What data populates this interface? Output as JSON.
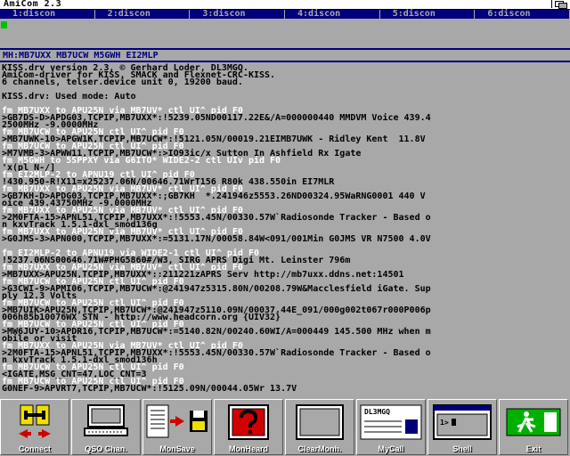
{
  "window": {
    "title": "AmiCom 2.3"
  },
  "channels": [
    {
      "label": "1:discon"
    },
    {
      "label": "2:discon"
    },
    {
      "label": "3:discon"
    },
    {
      "label": "4:discon"
    },
    {
      "label": "5:discon"
    },
    {
      "label": "6:discon"
    }
  ],
  "callsign_bar": "MH:MB7UXX MB7UCW M5GWH   EI2MLP",
  "monitor": {
    "lines": [
      {
        "t": "KISS.drv version 2.3, © Gerhard Loder, DL3MGQ.",
        "c": "b"
      },
      {
        "t": "AmiCom-driver for KISS, SMACK and Flexnet-CRC-KISS.",
        "c": "b"
      },
      {
        "t": "6 channels, telser.device unit 0, 19200 baud.",
        "c": "b"
      },
      {
        "t": "",
        "c": "b"
      },
      {
        "t": "KISS.drv: Used mode: Auto",
        "c": "b"
      },
      {
        "t": "",
        "c": "b"
      },
      {
        "t": "fm MB7UXX to APU25N via MB7UV* ctl UI^ pid F0",
        "c": "w"
      },
      {
        "t": ">GB7DS-D>APDG03,TCPIP,MB7UXX*:!5239.05ND00117.22E&/A=000000440 MMDVM Voice 439.4",
        "c": "b"
      },
      {
        "t": "2500MHz -9.0000MHz",
        "c": "b"
      },
      {
        "t": "fm MB7UCW to APU25N ctl UI^ pid F0",
        "c": "w"
      },
      {
        "t": ">MB7UWK-10>APGW1K,TCPIP,MB7UCW*:!5121.05N/00019.21EIMB7UWK - Ridley Kent  11.8V",
        "c": "b"
      },
      {
        "t": "fm MB7UCW to APU25N ctl UI^ pid F0",
        "c": "w"
      },
      {
        "t": ">M7VMB-3>APWW11,TCPIP,MB7UCW*:>IO93ic/x Sutton In Ashfield Rx Igate",
        "c": "b"
      },
      {
        "t": "fm M5GWH to 5SPPXY via G6ITO* WIDE2-2 ctl UIv pid F0",
        "c": "w"
      },
      {
        "t": "'x(pl N-/]",
        "c": "b"
      },
      {
        "t": "fm EI2MLP-2 to APNU19 ctl UI^ pid F0",
        "c": "w"
      },
      {
        "t": "!430.950-R!X11=x25237.06N/00646.71WrT156 R80k 438.550in EI7MLR",
        "c": "b"
      },
      {
        "t": "fm MB7UXX to APU25N via MB7UV* ctl UI^ pid F0",
        "c": "w"
      },
      {
        "t": ">GB7KH-D>APDG03,TCPIP,MB7UXX*:;GB7KH  *.241946z5553.26ND00324.95WaRNG0001 440 V",
        "c": "b"
      },
      {
        "t": "oice 439.43750MHz -9.0000MHz",
        "c": "b"
      },
      {
        "t": "fm MB7UXX to APU25N via MB7UV* ctl UI^ pid F0",
        "c": "w"
      },
      {
        "t": ">2M0FTA-15>APNL51,TCPIP,MB7UXX*:!5553.45N/00330.57W`Radiosonde Tracker - Based o",
        "c": "b"
      },
      {
        "t": "n kxvTrack 1.5.1-dxl_smod136g",
        "c": "b"
      },
      {
        "t": "fm MB7UXX to APU25N via MB7UV* ctl UI^ pid F0",
        "c": "w"
      },
      {
        "t": ">G0JMS-3>APN000,TCPIP,MB7UXX*:=5131.17N/00058.84W<091/001Min G0JMS VR N7500 4.0V",
        "c": "b"
      },
      {
        "t": "",
        "c": "b"
      },
      {
        "t": "fm EI2MLP-2 to APNU19 via WIDE2-1 ctl UI^ pid F0",
        "c": "w"
      },
      {
        "t": "!5237.06NS00646.71W#PHG5860#/W3, SIRG APRS Digi Mt. Leinster 796m",
        "c": "b"
      },
      {
        "t": "fm MB7UXX to APU25N via MB7UV* ctl UI^ pid F0",
        "c": "w"
      },
      {
        "t": ">MB7UXX>APU25N,TCPIP,MB7UXX*:;211221zAPRS Serv http://mb7uxx.ddns.net:14501",
        "c": "b"
      },
      {
        "t": "fm MB7UCW to APU25N ctl UI^ pid F0",
        "c": "w"
      },
      {
        "t": ">G3CWI-9>APMI06,TCPIP,MB7UCW*:@241947z5315.80N/00208.79W&Macclesfield iGate. Sup",
        "c": "b"
      },
      {
        "t": "ply 12.3 Volts",
        "c": "b"
      },
      {
        "t": "fm MB7UCW to APU25N ctl UI^ pid F0",
        "c": "w"
      },
      {
        "t": ">MB7UIK>APU25N,TCPIP,MB7UCW*:@241947z5110.09N/00037.44E_091/000g002t067r000P006p",
        "c": "b"
      },
      {
        "t": "006h85b10076WX STN - http://www.headcorn.org {UIV32}",
        "c": "b"
      },
      {
        "t": "fm MB7UCW to APU25N ctl UI^ pid F0",
        "c": "w"
      },
      {
        "t": ">MW6JUY-10>APDR16,TCPIP,MB7UCW*:=5140.82N/00240.60WI/A=000449 145.500 MHz when m",
        "c": "b"
      },
      {
        "t": "obile or visit",
        "c": "b"
      },
      {
        "t": "fm MB7UXX to APU25N via MB7UV* ctl UI^ pid F0",
        "c": "w"
      },
      {
        "t": ">2M0FTA-15>APNL51,TCPIP,MB7UXX*:!5553.45N/00330.57W`Radiosonde Tracker - Based o",
        "c": "b"
      },
      {
        "t": "n kxvTrack 1.5.1-dxl_smod136h",
        "c": "b"
      },
      {
        "t": "fm MB7UCW to APU25N ctl UI^ pid F0",
        "c": "w"
      },
      {
        "t": "<IGATE,MSG_CNT=47,LOC_CNT=3",
        "c": "b"
      },
      {
        "t": "fm MB7UCW to APU25N ctl UI^ pid F0",
        "c": "w"
      },
      {
        "t": "G0NEF-9>APVRT7,TCPIP,MB7UCW*:!5125.09N/00044.05Wr 13.7V",
        "c": "b"
      }
    ]
  },
  "toolbar": {
    "buttons": [
      {
        "label": "Connect"
      },
      {
        "label": "QSO Chan."
      },
      {
        "label": "MonSave"
      },
      {
        "label": "MonHeard"
      },
      {
        "label": "ClearMonh."
      },
      {
        "label": "MyCall",
        "badge": "DL3MGQ"
      },
      {
        "label": "Shell",
        "badge": "1>"
      },
      {
        "label": "Exit"
      }
    ]
  },
  "colors": {
    "screen_bg": "#a8a8a8",
    "tab_bg": "#00007c",
    "cursor": "#00c000",
    "exit_green": "#00b000"
  }
}
